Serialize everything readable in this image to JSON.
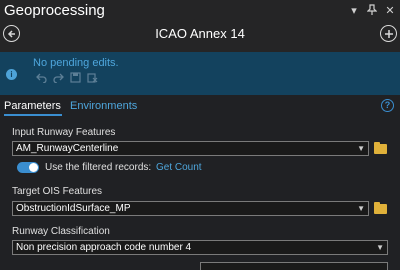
{
  "pane": {
    "title": "Geoprocessing",
    "controls": [
      "chevron-down-icon",
      "pin-icon",
      "close-icon"
    ]
  },
  "tool": {
    "name": "ICAO Annex 14"
  },
  "edits": {
    "message": "No pending edits."
  },
  "tabs": {
    "parameters": "Parameters",
    "environments": "Environments"
  },
  "params": {
    "input_runway": {
      "label": "Input Runway Features",
      "value": "AM_RunwayCenterline"
    },
    "filtered": {
      "label": "Use the filtered records:",
      "link": "Get Count",
      "enabled": true
    },
    "target_ois": {
      "label": "Target OIS Features",
      "value": "ObstructionIdSurface_MP"
    },
    "runway_class": {
      "label": "Runway Classification",
      "value": "Non precision approach code number 4"
    }
  },
  "colors": {
    "accent": "#3a8ed0",
    "link": "#4ea6dc",
    "banner": "#13425e",
    "folder": "#e0b13a"
  }
}
